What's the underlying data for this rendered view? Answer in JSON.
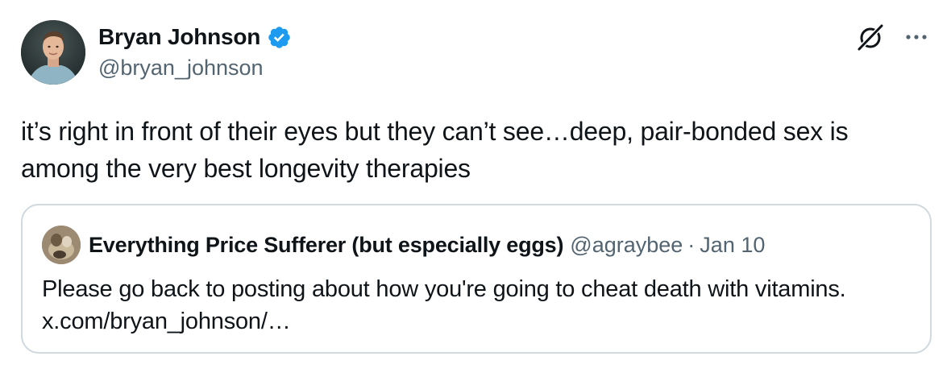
{
  "author": {
    "name": "Bryan Johnson",
    "handle": "@bryan_johnson",
    "verified": true,
    "verified_color": "#1d9bf0"
  },
  "header": {
    "grok_icon": "grok-slash-icon",
    "more_icon": "ellipsis-icon"
  },
  "tweet": {
    "text": "it’s right in front of their eyes but they can’t see…deep, pair-bonded sex is among the very best longevity therapies"
  },
  "quoted_tweet": {
    "author_name": "Everything Price Sufferer (but especially eggs)",
    "handle": "@agraybee",
    "separator": "·",
    "date": "Jan 10",
    "text_line1": "Please go back to posting about how you're going to cheat death with vitamins.",
    "text_line2": "x.com/bryan_johnson/…"
  },
  "colors": {
    "text_primary": "#0f1419",
    "text_secondary": "#536471",
    "border": "#cfd9de",
    "accent": "#1d9bf0"
  }
}
